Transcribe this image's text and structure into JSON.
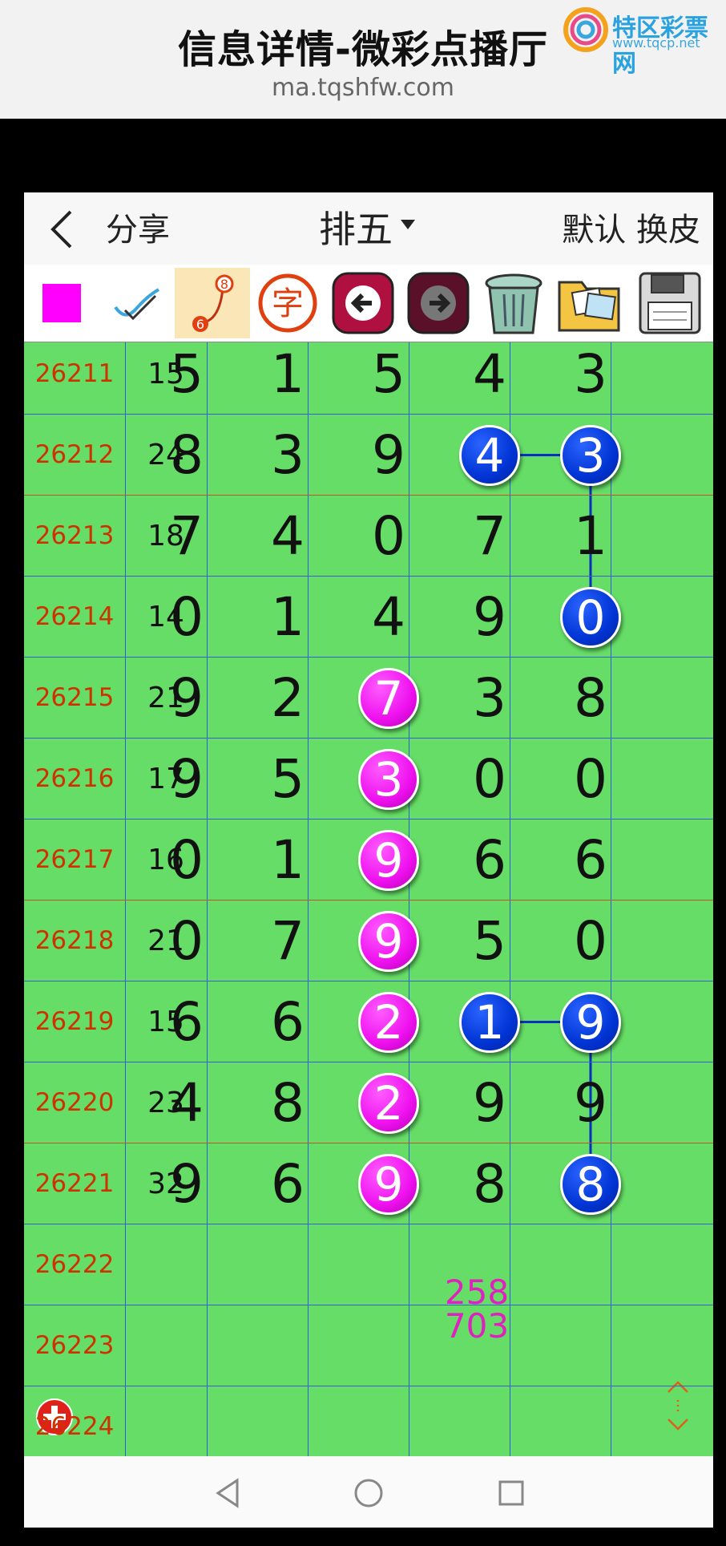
{
  "header": {
    "title": "信息详情-微彩点播厅",
    "url": "ma.tqshfw.com",
    "logo_name": "特区彩票网",
    "logo_url": "www.tqcp.net"
  },
  "navbar": {
    "share_label": "分享",
    "lottery_name": "排五",
    "skin_label": "默认 换皮"
  },
  "toolbar": {
    "items": [
      "color-swatch",
      "check-pen-icon",
      "link-icon",
      "char-icon",
      "prev-icon",
      "next-icon",
      "trash-icon",
      "photos-icon",
      "save-icon"
    ],
    "active": "link-icon",
    "swatch_color": "#ff00ff"
  },
  "colors": {
    "grid_bg": "#66dd66",
    "issue_text": "#cc3300",
    "ball_blue": "#0a3ee6",
    "ball_pink": "#ee10ee",
    "prediction": "#e020c0"
  },
  "rows": [
    {
      "issue": "26211",
      "sum": "15",
      "digits": [
        "5",
        "1",
        "5",
        "4",
        "3"
      ]
    },
    {
      "issue": "26212",
      "sum": "24",
      "digits": [
        "8",
        "3",
        "9",
        "4",
        "3"
      ]
    },
    {
      "issue": "26213",
      "sum": "18",
      "digits": [
        "7",
        "4",
        "0",
        "7",
        "1"
      ]
    },
    {
      "issue": "26214",
      "sum": "14",
      "digits": [
        "0",
        "1",
        "4",
        "9",
        "0"
      ]
    },
    {
      "issue": "26215",
      "sum": "21",
      "digits": [
        "9",
        "2",
        "7",
        "3",
        "8"
      ]
    },
    {
      "issue": "26216",
      "sum": "17",
      "digits": [
        "9",
        "5",
        "3",
        "0",
        "0"
      ]
    },
    {
      "issue": "26217",
      "sum": "16",
      "digits": [
        "0",
        "1",
        "9",
        "6",
        "6"
      ]
    },
    {
      "issue": "26218",
      "sum": "21",
      "digits": [
        "0",
        "7",
        "9",
        "5",
        "0"
      ]
    },
    {
      "issue": "26219",
      "sum": "15",
      "digits": [
        "6",
        "6",
        "2",
        "1",
        "9"
      ]
    },
    {
      "issue": "26220",
      "sum": "23",
      "digits": [
        "4",
        "8",
        "2",
        "9",
        "9"
      ]
    },
    {
      "issue": "26221",
      "sum": "32",
      "digits": [
        "9",
        "6",
        "9",
        "8",
        "8"
      ]
    },
    {
      "issue": "26222",
      "sum": "",
      "digits": [
        "",
        "",
        "",
        "",
        ""
      ]
    },
    {
      "issue": "26223",
      "sum": "",
      "digits": [
        "",
        "",
        "",
        "",
        ""
      ]
    },
    {
      "issue": "26224",
      "sum": "",
      "digits": [
        "",
        "",
        "",
        "",
        ""
      ]
    }
  ],
  "highlights": [
    {
      "row": 1,
      "col": 3,
      "color": "blue"
    },
    {
      "row": 1,
      "col": 4,
      "color": "blue"
    },
    {
      "row": 3,
      "col": 4,
      "color": "blue"
    },
    {
      "row": 8,
      "col": 3,
      "color": "blue"
    },
    {
      "row": 8,
      "col": 4,
      "color": "blue"
    },
    {
      "row": 10,
      "col": 4,
      "color": "blue"
    },
    {
      "row": 4,
      "col": 2,
      "color": "pink"
    },
    {
      "row": 5,
      "col": 2,
      "color": "pink"
    },
    {
      "row": 6,
      "col": 2,
      "color": "pink"
    },
    {
      "row": 7,
      "col": 2,
      "color": "pink"
    },
    {
      "row": 8,
      "col": 2,
      "color": "pink"
    },
    {
      "row": 9,
      "col": 2,
      "color": "pink"
    },
    {
      "row": 10,
      "col": 2,
      "color": "pink"
    }
  ],
  "prediction": {
    "line1": "258",
    "line2": "703"
  }
}
